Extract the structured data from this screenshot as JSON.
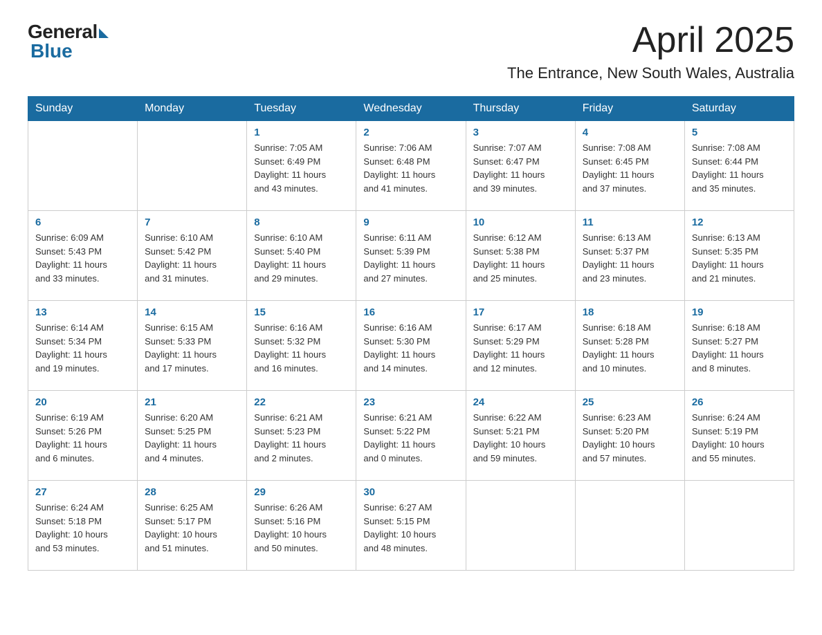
{
  "header": {
    "logo_general": "General",
    "logo_blue": "Blue",
    "month_title": "April 2025",
    "location": "The Entrance, New South Wales, Australia"
  },
  "weekdays": [
    "Sunday",
    "Monday",
    "Tuesday",
    "Wednesday",
    "Thursday",
    "Friday",
    "Saturday"
  ],
  "weeks": [
    [
      {
        "day": "",
        "info": ""
      },
      {
        "day": "",
        "info": ""
      },
      {
        "day": "1",
        "info": "Sunrise: 7:05 AM\nSunset: 6:49 PM\nDaylight: 11 hours\nand 43 minutes."
      },
      {
        "day": "2",
        "info": "Sunrise: 7:06 AM\nSunset: 6:48 PM\nDaylight: 11 hours\nand 41 minutes."
      },
      {
        "day": "3",
        "info": "Sunrise: 7:07 AM\nSunset: 6:47 PM\nDaylight: 11 hours\nand 39 minutes."
      },
      {
        "day": "4",
        "info": "Sunrise: 7:08 AM\nSunset: 6:45 PM\nDaylight: 11 hours\nand 37 minutes."
      },
      {
        "day": "5",
        "info": "Sunrise: 7:08 AM\nSunset: 6:44 PM\nDaylight: 11 hours\nand 35 minutes."
      }
    ],
    [
      {
        "day": "6",
        "info": "Sunrise: 6:09 AM\nSunset: 5:43 PM\nDaylight: 11 hours\nand 33 minutes."
      },
      {
        "day": "7",
        "info": "Sunrise: 6:10 AM\nSunset: 5:42 PM\nDaylight: 11 hours\nand 31 minutes."
      },
      {
        "day": "8",
        "info": "Sunrise: 6:10 AM\nSunset: 5:40 PM\nDaylight: 11 hours\nand 29 minutes."
      },
      {
        "day": "9",
        "info": "Sunrise: 6:11 AM\nSunset: 5:39 PM\nDaylight: 11 hours\nand 27 minutes."
      },
      {
        "day": "10",
        "info": "Sunrise: 6:12 AM\nSunset: 5:38 PM\nDaylight: 11 hours\nand 25 minutes."
      },
      {
        "day": "11",
        "info": "Sunrise: 6:13 AM\nSunset: 5:37 PM\nDaylight: 11 hours\nand 23 minutes."
      },
      {
        "day": "12",
        "info": "Sunrise: 6:13 AM\nSunset: 5:35 PM\nDaylight: 11 hours\nand 21 minutes."
      }
    ],
    [
      {
        "day": "13",
        "info": "Sunrise: 6:14 AM\nSunset: 5:34 PM\nDaylight: 11 hours\nand 19 minutes."
      },
      {
        "day": "14",
        "info": "Sunrise: 6:15 AM\nSunset: 5:33 PM\nDaylight: 11 hours\nand 17 minutes."
      },
      {
        "day": "15",
        "info": "Sunrise: 6:16 AM\nSunset: 5:32 PM\nDaylight: 11 hours\nand 16 minutes."
      },
      {
        "day": "16",
        "info": "Sunrise: 6:16 AM\nSunset: 5:30 PM\nDaylight: 11 hours\nand 14 minutes."
      },
      {
        "day": "17",
        "info": "Sunrise: 6:17 AM\nSunset: 5:29 PM\nDaylight: 11 hours\nand 12 minutes."
      },
      {
        "day": "18",
        "info": "Sunrise: 6:18 AM\nSunset: 5:28 PM\nDaylight: 11 hours\nand 10 minutes."
      },
      {
        "day": "19",
        "info": "Sunrise: 6:18 AM\nSunset: 5:27 PM\nDaylight: 11 hours\nand 8 minutes."
      }
    ],
    [
      {
        "day": "20",
        "info": "Sunrise: 6:19 AM\nSunset: 5:26 PM\nDaylight: 11 hours\nand 6 minutes."
      },
      {
        "day": "21",
        "info": "Sunrise: 6:20 AM\nSunset: 5:25 PM\nDaylight: 11 hours\nand 4 minutes."
      },
      {
        "day": "22",
        "info": "Sunrise: 6:21 AM\nSunset: 5:23 PM\nDaylight: 11 hours\nand 2 minutes."
      },
      {
        "day": "23",
        "info": "Sunrise: 6:21 AM\nSunset: 5:22 PM\nDaylight: 11 hours\nand 0 minutes."
      },
      {
        "day": "24",
        "info": "Sunrise: 6:22 AM\nSunset: 5:21 PM\nDaylight: 10 hours\nand 59 minutes."
      },
      {
        "day": "25",
        "info": "Sunrise: 6:23 AM\nSunset: 5:20 PM\nDaylight: 10 hours\nand 57 minutes."
      },
      {
        "day": "26",
        "info": "Sunrise: 6:24 AM\nSunset: 5:19 PM\nDaylight: 10 hours\nand 55 minutes."
      }
    ],
    [
      {
        "day": "27",
        "info": "Sunrise: 6:24 AM\nSunset: 5:18 PM\nDaylight: 10 hours\nand 53 minutes."
      },
      {
        "day": "28",
        "info": "Sunrise: 6:25 AM\nSunset: 5:17 PM\nDaylight: 10 hours\nand 51 minutes."
      },
      {
        "day": "29",
        "info": "Sunrise: 6:26 AM\nSunset: 5:16 PM\nDaylight: 10 hours\nand 50 minutes."
      },
      {
        "day": "30",
        "info": "Sunrise: 6:27 AM\nSunset: 5:15 PM\nDaylight: 10 hours\nand 48 minutes."
      },
      {
        "day": "",
        "info": ""
      },
      {
        "day": "",
        "info": ""
      },
      {
        "day": "",
        "info": ""
      }
    ]
  ]
}
